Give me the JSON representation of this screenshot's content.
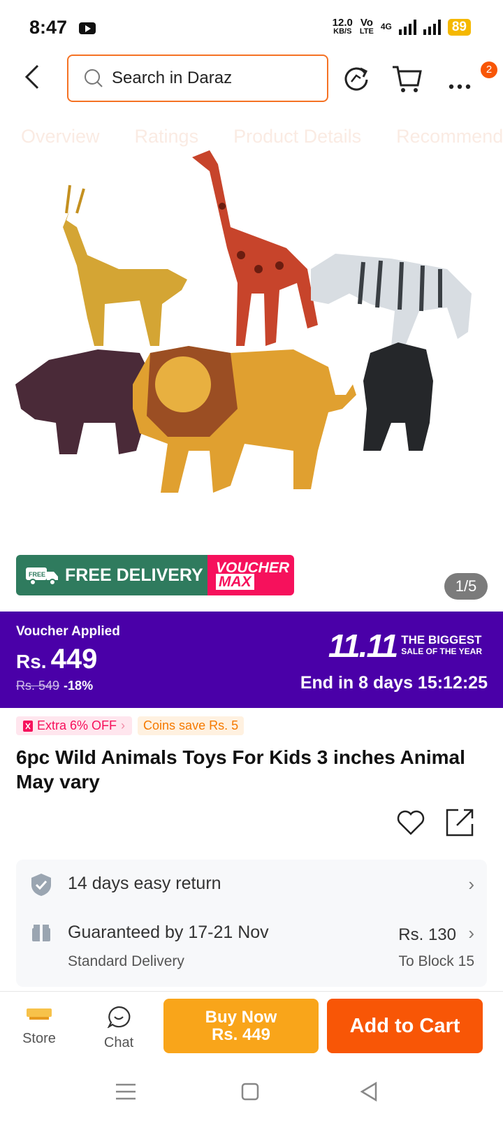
{
  "status_bar": {
    "time": "8:47",
    "net_speed": "12.0",
    "net_unit": "KB/S",
    "volte": "Vo",
    "lte": "LTE",
    "gen": "4G",
    "battery": "89"
  },
  "header": {
    "search_placeholder": "Search in Daraz",
    "cart_badge": "2"
  },
  "tabs": [
    "Overview",
    "Ratings",
    "Product Details",
    "Recommended"
  ],
  "promo": {
    "free_tag": "FREE",
    "free_delivery": "FREE DELIVERY",
    "voucher": "VOUCHER",
    "max": "MAX"
  },
  "image_pager": "1/5",
  "price": {
    "voucher_label": "Voucher Applied",
    "currency": "Rs.",
    "amount": "449",
    "original": "Rs. 549",
    "discount": "-18%",
    "sale_number": "11.11",
    "sale_line1": "THE BIGGEST",
    "sale_line2": "SALE OF THE YEAR",
    "countdown": "End in 8 days 15:12:25"
  },
  "chips": {
    "extra_off": "Extra 6% OFF",
    "coins": "Coins save Rs. 5"
  },
  "product_title": "6pc Wild Animals Toys For Kids 3 inches Animal May vary",
  "service": {
    "return_text": "14 days easy return",
    "delivery_text": "Guaranteed by 17-21 Nov",
    "delivery_type": "Standard Delivery",
    "delivery_price": "Rs. 130",
    "delivery_to": "To Block 15"
  },
  "actions": {
    "store": "Store",
    "chat": "Chat",
    "buy_now": "Buy Now",
    "buy_price": "Rs. 449",
    "add_to_cart": "Add to Cart"
  },
  "colors": {
    "brand_orange": "#f85606",
    "buy_yellow": "#f9a51a",
    "price_band": "#4a00a8",
    "voucher_pink": "#f6115c"
  }
}
